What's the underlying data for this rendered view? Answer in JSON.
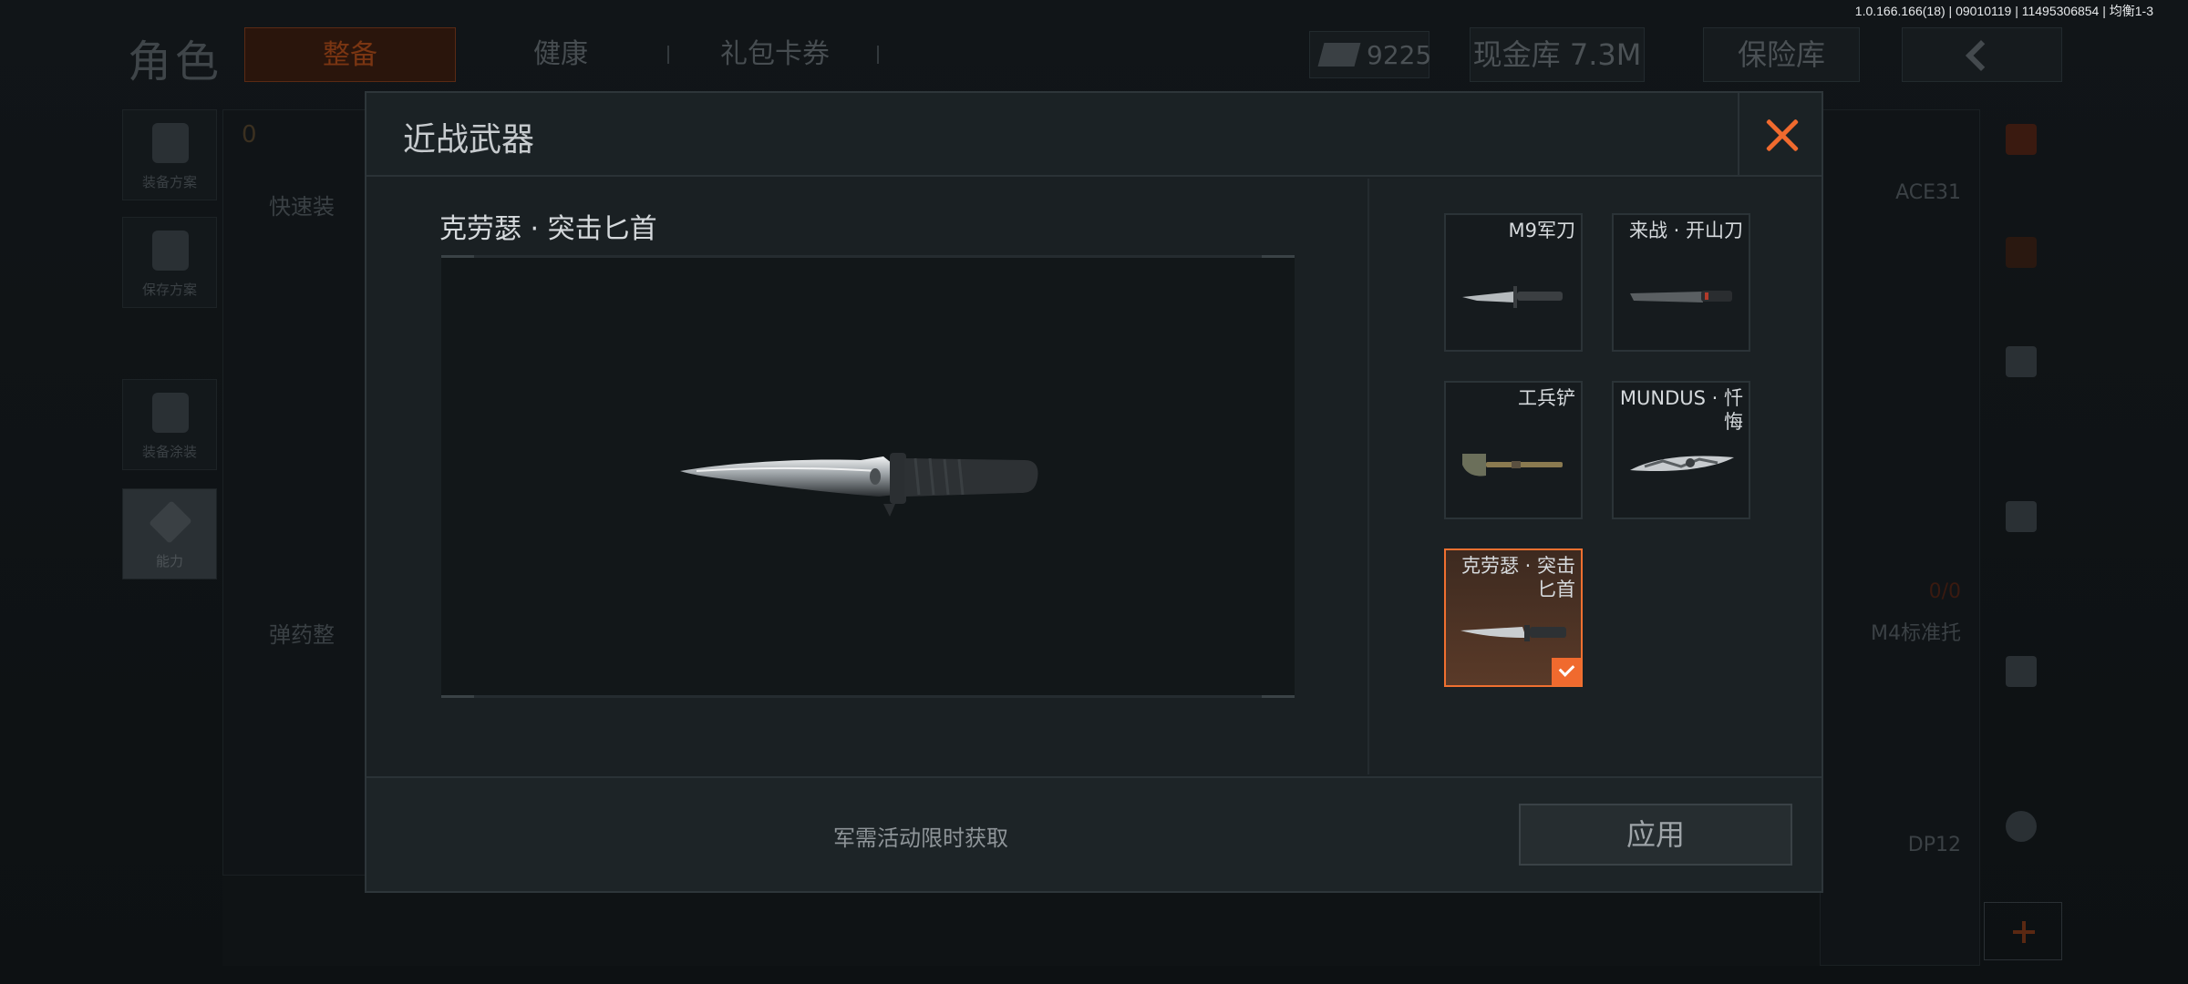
{
  "version_info": "1.0.166.166(18) | 09010119 | 11495306854 | 均衡1-3",
  "background": {
    "title": "角色",
    "tabs": [
      {
        "label": "整备",
        "active": true
      },
      {
        "label": "健康",
        "active": false
      },
      {
        "label": "礼包卡券",
        "active": false
      }
    ],
    "currency_amount": "9225",
    "cash_label": "现金库 7.3M",
    "vault_label": "保险库",
    "left_menu": [
      {
        "label": "装备方案",
        "icon": "armor-vest-icon"
      },
      {
        "label": "保存方案",
        "icon": "download-icon"
      },
      {
        "label": "装备涂装",
        "icon": "operator-icon"
      },
      {
        "label": "能力",
        "icon": "ability-bolt-icon"
      }
    ],
    "mid_labels": {
      "quick_equip": "快速装",
      "ammo": "弹药整",
      "count": "0"
    },
    "right_labels": {
      "ace": "ACE31",
      "m4": "M4标准托",
      "dp": "DP12",
      "ammo_count": "0/0"
    }
  },
  "modal": {
    "title": "近战武器",
    "selected_weapon_name": "克劳瑟 · 突击匕首",
    "items": [
      {
        "label": "M9军刀",
        "thumb": "bayonet-icon",
        "selected": false
      },
      {
        "label": "来战 · 开山刀",
        "thumb": "machete-icon",
        "selected": false
      },
      {
        "label": "工兵铲",
        "thumb": "shovel-icon",
        "selected": false
      },
      {
        "label": "MUNDUS · 忏悔",
        "thumb": "ornate-blade-icon",
        "selected": false
      },
      {
        "label": "克劳瑟 · 突击匕首",
        "thumb": "combat-knife-icon",
        "selected": true
      }
    ],
    "footer_note": "军需活动限时获取",
    "apply_label": "应用"
  },
  "colors": {
    "accent": "#f06a2e",
    "panel": "#1a2023",
    "preview_bg": "#121719"
  }
}
